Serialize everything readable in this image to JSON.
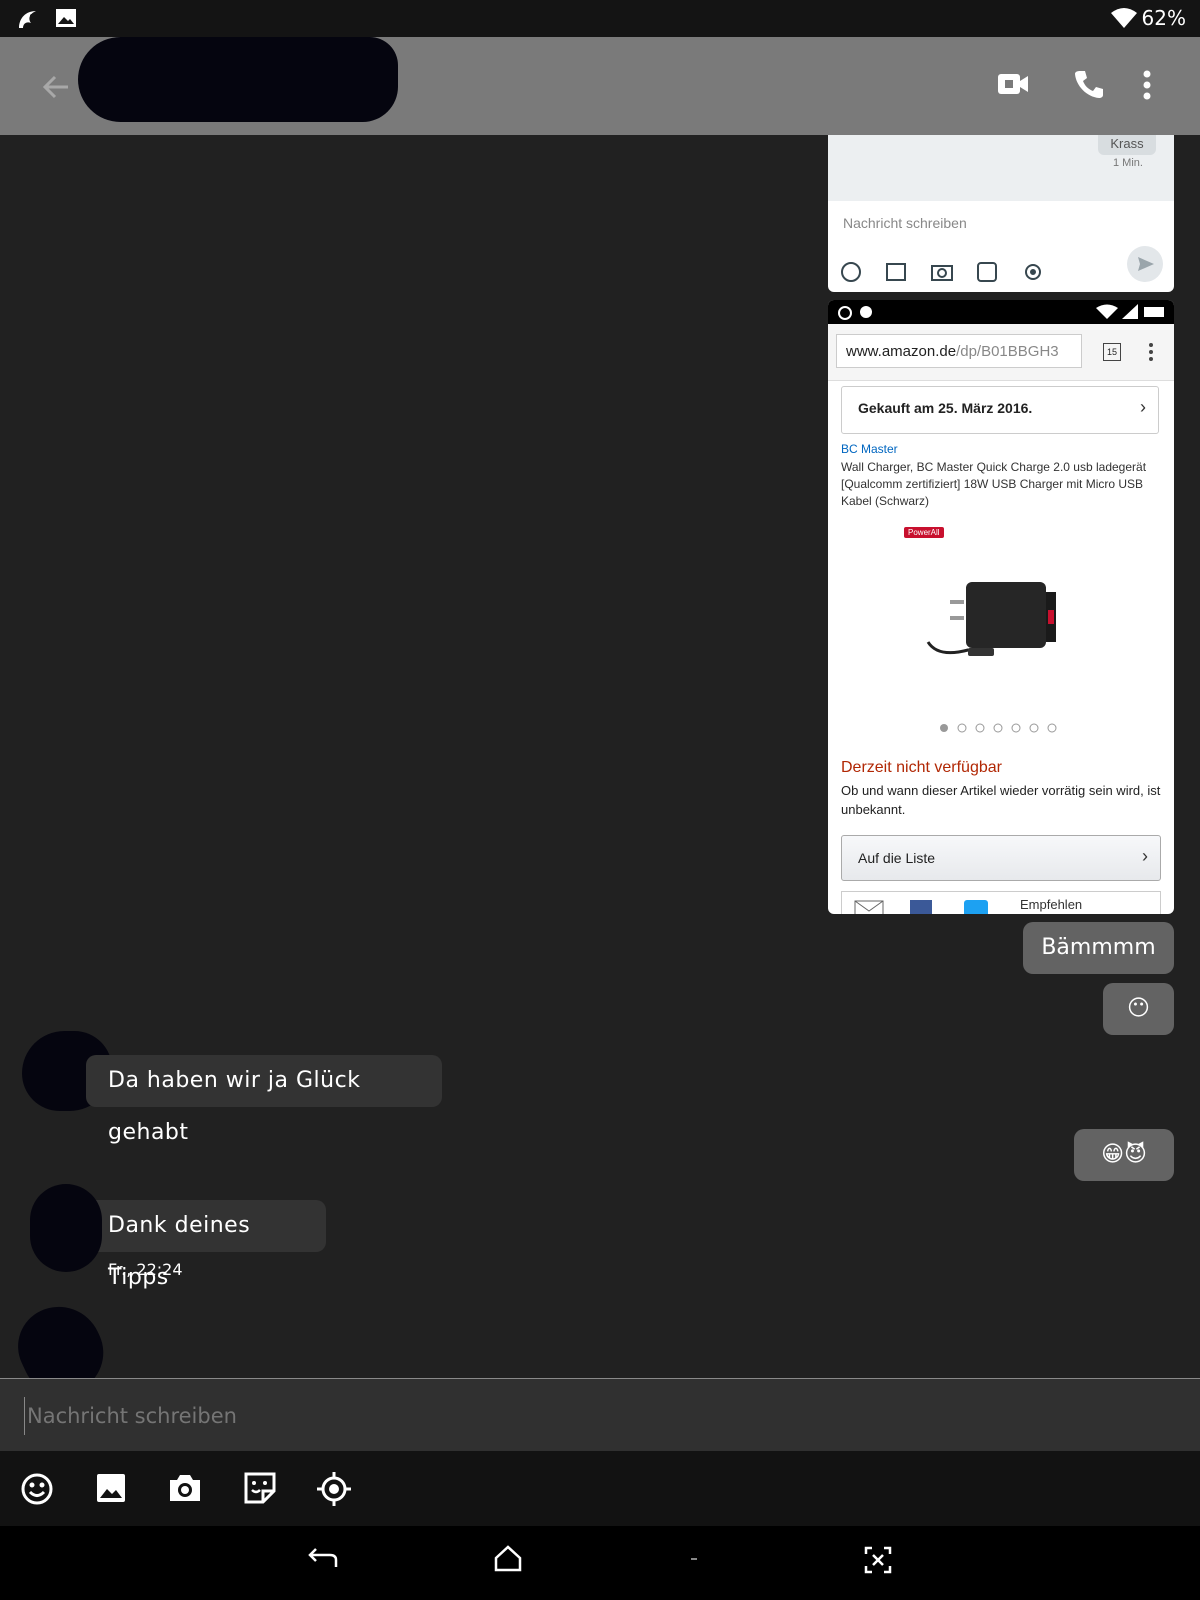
{
  "status_bar": {
    "battery": "62%"
  },
  "screenshot_top": {
    "bubble_text": "Krass",
    "bubble_time": "1 Min.",
    "input_placeholder": "Nachricht schreiben"
  },
  "screenshot_amazon": {
    "url_host": "www.amazon.de",
    "url_path": "/dp/B01BBGH3",
    "tab_count": "15",
    "purchased": "Gekauft am 25. März 2016.",
    "brand": "BC Master",
    "product_title": "Wall Charger, BC Master Quick Charge 2.0 usb ladegerät [Qualcomm zertifiziert] 18W USB Charger mit Micro USB Kabel (Schwarz)",
    "badge": "PowerAll",
    "unavailable": "Derzeit nicht verfügbar",
    "unavailable_note": "Ob und wann dieser Artikel wieder vorrätig sein wird, ist unbekannt.",
    "list_button": "Auf die Liste",
    "recommend": "Empfehlen"
  },
  "messages": {
    "out_1": "Bämmmm",
    "out_2": "😶",
    "in_1": "Da haben wir ja Glück gehabt",
    "out_3": "😁😈",
    "in_2": "Dank deines Tipps",
    "in_2_time": "Fr., 22:24"
  },
  "composer": {
    "placeholder": "Nachricht schreiben"
  },
  "colors": {
    "toolbar": "#7a7a7a",
    "background": "#212121",
    "unavailable": "#b12704",
    "brand_link": "#0066c0"
  }
}
